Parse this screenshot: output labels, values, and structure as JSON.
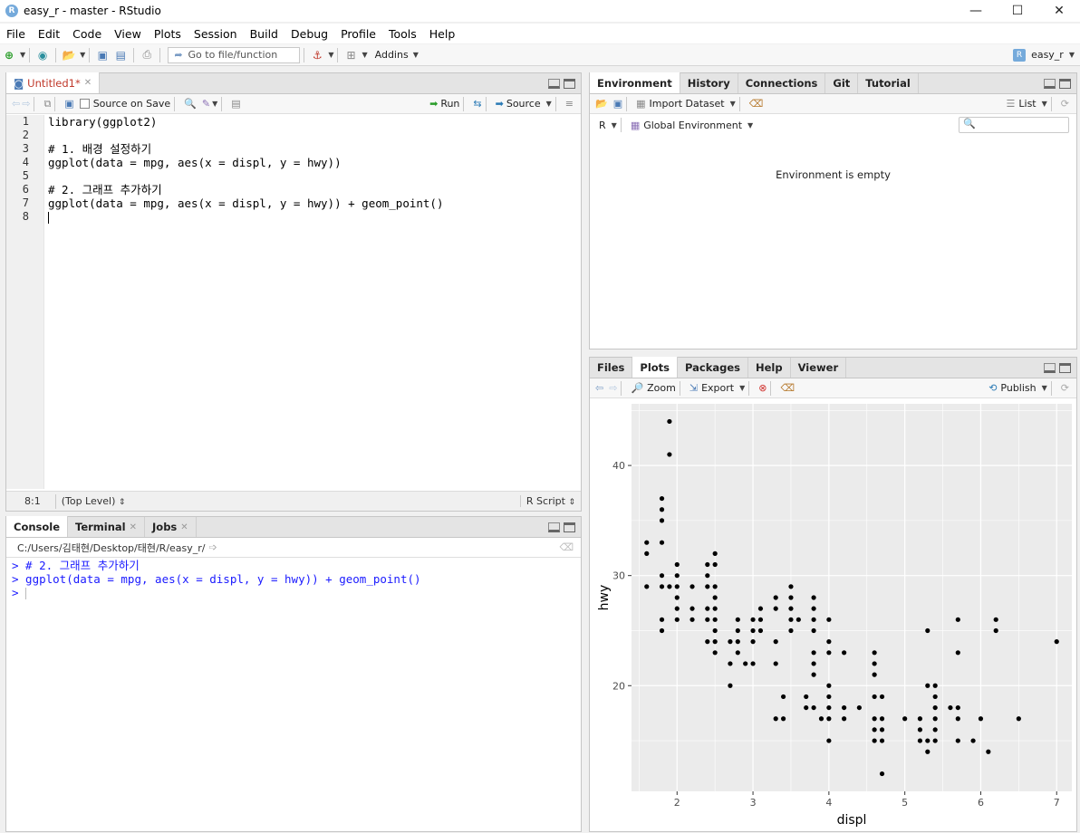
{
  "window": {
    "title": "easy_r - master - RStudio",
    "controls": [
      "—",
      "☐",
      "✕"
    ]
  },
  "menu": [
    "File",
    "Edit",
    "Code",
    "View",
    "Plots",
    "Session",
    "Build",
    "Debug",
    "Profile",
    "Tools",
    "Help"
  ],
  "toolbar": {
    "goto_placeholder": "Go to file/function",
    "addins_label": "Addins",
    "project_label": "easy_r"
  },
  "editor": {
    "tab_label": "Untitled1*",
    "source_on_save_label": "Source on Save",
    "run_label": "Run",
    "source_label": "Source",
    "lines": [
      {
        "num": "1",
        "text": "library(ggplot2)",
        "style": "kw"
      },
      {
        "num": "2",
        "text": "",
        "style": "plain"
      },
      {
        "num": "3",
        "text": "# 1. 배경 설정하기",
        "style": "cm"
      },
      {
        "num": "4",
        "text": "ggplot(data = mpg, aes(x = displ, y = hwy))",
        "style": "plain"
      },
      {
        "num": "5",
        "text": "",
        "style": "plain"
      },
      {
        "num": "6",
        "text": "# 2. 그래프 추가하기",
        "style": "cm"
      },
      {
        "num": "7",
        "text": "ggplot(data = mpg, aes(x = displ, y = hwy)) + geom_point()",
        "style": "plain"
      },
      {
        "num": "8",
        "text": "",
        "style": "cursor"
      }
    ],
    "status_position": "8:1",
    "status_scope": "(Top Level)",
    "status_type": "R Script"
  },
  "console": {
    "tabs": [
      "Console",
      "Terminal",
      "Jobs"
    ],
    "path": "C:/Users/김태현/Desktop/태현/R/easy_r/",
    "lines": [
      "> # 2. 그래프 추가하기",
      "> ggplot(data = mpg, aes(x = displ, y = hwy)) + geom_point()",
      "> "
    ]
  },
  "environment": {
    "tabs": [
      "Environment",
      "History",
      "Connections",
      "Git",
      "Tutorial"
    ],
    "import_label": "Import Dataset",
    "list_label": "List",
    "r_label": "R",
    "global_env_label": "Global Environment",
    "empty_message": "Environment is empty"
  },
  "files": {
    "tabs": [
      "Files",
      "Plots",
      "Packages",
      "Help",
      "Viewer"
    ],
    "zoom_label": "Zoom",
    "export_label": "Export",
    "publish_label": "Publish"
  },
  "chart_data": {
    "type": "scatter",
    "title": "",
    "xlabel": "displ",
    "ylabel": "hwy",
    "xlim": [
      1.4,
      7.2
    ],
    "ylim": [
      10.4,
      45.6
    ],
    "xticks": [
      2,
      3,
      4,
      5,
      6,
      7
    ],
    "yticks": [
      20,
      30,
      40
    ],
    "grid": true,
    "colors": {
      "panel": "#ebebeb",
      "grid": "#ffffff",
      "point": "#000000"
    },
    "points": [
      [
        1.6,
        33
      ],
      [
        1.6,
        32
      ],
      [
        1.6,
        29
      ],
      [
        1.8,
        29
      ],
      [
        1.8,
        26
      ],
      [
        1.8,
        25
      ],
      [
        1.8,
        30
      ],
      [
        1.8,
        33
      ],
      [
        1.8,
        35
      ],
      [
        1.8,
        36
      ],
      [
        1.8,
        37
      ],
      [
        1.9,
        44
      ],
      [
        1.9,
        41
      ],
      [
        1.9,
        29
      ],
      [
        2.0,
        31
      ],
      [
        2.0,
        30
      ],
      [
        2.0,
        29
      ],
      [
        2.0,
        28
      ],
      [
        2.0,
        27
      ],
      [
        2.0,
        26
      ],
      [
        2.2,
        29
      ],
      [
        2.2,
        27
      ],
      [
        2.2,
        26
      ],
      [
        2.4,
        31
      ],
      [
        2.4,
        30
      ],
      [
        2.4,
        29
      ],
      [
        2.4,
        27
      ],
      [
        2.4,
        26
      ],
      [
        2.4,
        24
      ],
      [
        2.5,
        32
      ],
      [
        2.5,
        31
      ],
      [
        2.5,
        29
      ],
      [
        2.5,
        28
      ],
      [
        2.5,
        27
      ],
      [
        2.5,
        26
      ],
      [
        2.5,
        25
      ],
      [
        2.5,
        24
      ],
      [
        2.5,
        23
      ],
      [
        2.7,
        24
      ],
      [
        2.7,
        22
      ],
      [
        2.7,
        20
      ],
      [
        2.8,
        26
      ],
      [
        2.8,
        25
      ],
      [
        2.8,
        24
      ],
      [
        2.8,
        23
      ],
      [
        2.9,
        22
      ],
      [
        3.0,
        26
      ],
      [
        3.0,
        25
      ],
      [
        3.0,
        24
      ],
      [
        3.0,
        22
      ],
      [
        3.1,
        27
      ],
      [
        3.1,
        26
      ],
      [
        3.1,
        25
      ],
      [
        3.3,
        28
      ],
      [
        3.3,
        27
      ],
      [
        3.3,
        24
      ],
      [
        3.3,
        22
      ],
      [
        3.3,
        17
      ],
      [
        3.4,
        19
      ],
      [
        3.4,
        17
      ],
      [
        3.5,
        29
      ],
      [
        3.5,
        28
      ],
      [
        3.5,
        27
      ],
      [
        3.5,
        26
      ],
      [
        3.5,
        25
      ],
      [
        3.6,
        26
      ],
      [
        3.7,
        19
      ],
      [
        3.7,
        18
      ],
      [
        3.8,
        28
      ],
      [
        3.8,
        27
      ],
      [
        3.8,
        26
      ],
      [
        3.8,
        25
      ],
      [
        3.8,
        23
      ],
      [
        3.8,
        22
      ],
      [
        3.8,
        21
      ],
      [
        3.8,
        18
      ],
      [
        3.9,
        17
      ],
      [
        4.0,
        26
      ],
      [
        4.0,
        24
      ],
      [
        4.0,
        23
      ],
      [
        4.0,
        20
      ],
      [
        4.0,
        19
      ],
      [
        4.0,
        18
      ],
      [
        4.0,
        17
      ],
      [
        4.0,
        15
      ],
      [
        4.2,
        23
      ],
      [
        4.2,
        18
      ],
      [
        4.2,
        17
      ],
      [
        4.4,
        18
      ],
      [
        4.6,
        23
      ],
      [
        4.6,
        22
      ],
      [
        4.6,
        21
      ],
      [
        4.6,
        19
      ],
      [
        4.6,
        17
      ],
      [
        4.6,
        16
      ],
      [
        4.6,
        15
      ],
      [
        4.7,
        19
      ],
      [
        4.7,
        17
      ],
      [
        4.7,
        16
      ],
      [
        4.7,
        15
      ],
      [
        4.7,
        12
      ],
      [
        5.0,
        17
      ],
      [
        5.2,
        17
      ],
      [
        5.2,
        16
      ],
      [
        5.2,
        15
      ],
      [
        5.3,
        25
      ],
      [
        5.3,
        15
      ],
      [
        5.3,
        14
      ],
      [
        5.4,
        20
      ],
      [
        5.4,
        19
      ],
      [
        5.4,
        18
      ],
      [
        5.4,
        17
      ],
      [
        5.4,
        16
      ],
      [
        5.4,
        15
      ],
      [
        5.3,
        20
      ],
      [
        5.6,
        18
      ],
      [
        5.7,
        26
      ],
      [
        5.7,
        23
      ],
      [
        5.7,
        18
      ],
      [
        5.7,
        17
      ],
      [
        5.7,
        15
      ],
      [
        5.9,
        15
      ],
      [
        6.0,
        17
      ],
      [
        6.1,
        14
      ],
      [
        6.2,
        26
      ],
      [
        6.2,
        25
      ],
      [
        6.5,
        17
      ],
      [
        7.0,
        24
      ]
    ]
  }
}
